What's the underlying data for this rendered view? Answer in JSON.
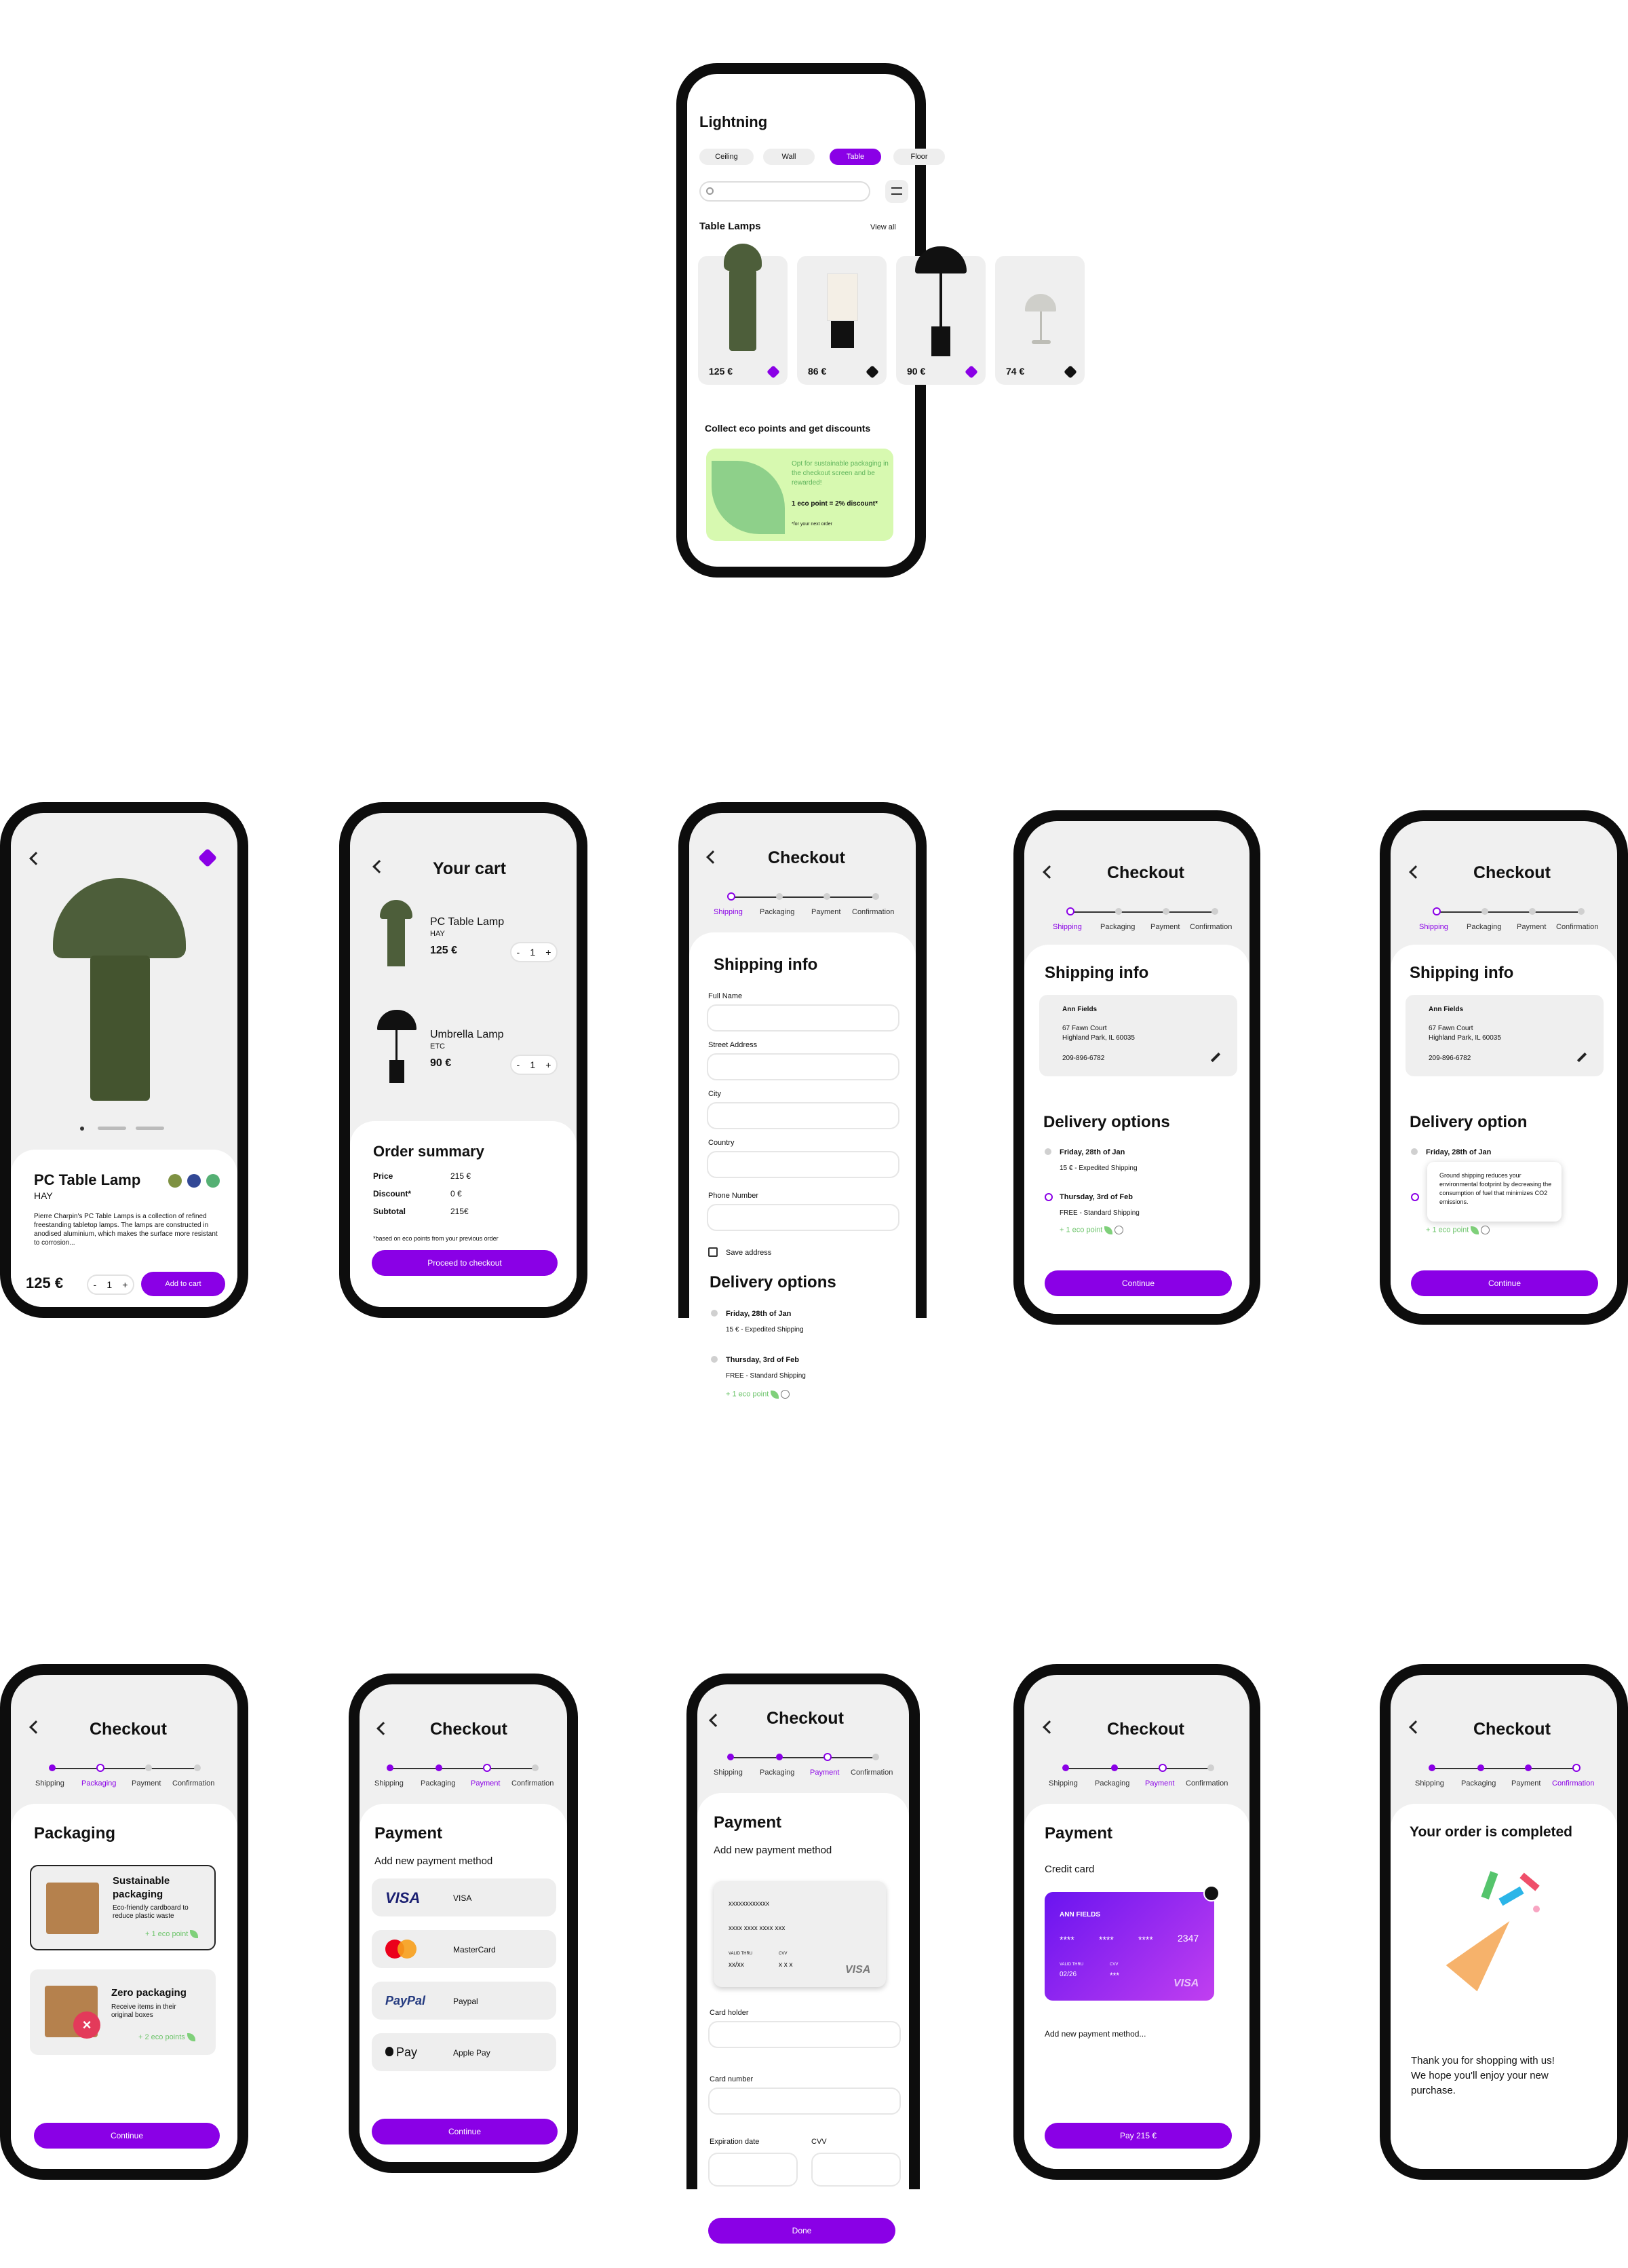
{
  "catalog": {
    "title": "Lightning",
    "chips": [
      "Ceiling",
      "Wall",
      "Table",
      "Floor"
    ],
    "section": "Table Lamps",
    "view_all": "View all",
    "prices": [
      "125 €",
      "86 €",
      "90 €",
      "74 €"
    ],
    "eco_title": "Collect eco points and get discounts",
    "eco_text1": "Opt for sustainable packaging in the checkout screen and be rewarded!",
    "eco_text2": "1 eco point = 2% discount*",
    "eco_text3": "*for your next order"
  },
  "product": {
    "name": "PC Table Lamp",
    "brand": "HAY",
    "desc": "Pierre Charpin's PC Table Lamps is a collection of refined freestanding tabletop lamps. The lamps are constructed in anodised aluminium, which makes the surface more resistant to corrosion...",
    "price": "125 €",
    "qty": "1",
    "add": "Add to cart"
  },
  "cart": {
    "title": "Your cart",
    "items": [
      {
        "name": "PC Table Lamp",
        "brand": "HAY",
        "price": "125 €",
        "qty": "1"
      },
      {
        "name": "Umbrella Lamp",
        "brand": "ETC",
        "price": "90 €",
        "qty": "1"
      }
    ],
    "summary": "Order summary",
    "rows": [
      {
        "k": "Price",
        "v": "215 €"
      },
      {
        "k": "Discount*",
        "v": "0 €"
      },
      {
        "k": "Subtotal",
        "v": "215€"
      }
    ],
    "note": "*based on eco points from your previous order",
    "cta": "Proceed to checkout"
  },
  "checkout": {
    "title": "Checkout",
    "steps": [
      "Shipping",
      "Packaging",
      "Payment",
      "Confirmation"
    ]
  },
  "shipping": {
    "title": "Shipping info",
    "fields": [
      "Full Name",
      "Street Address",
      "City",
      "Country",
      "Phone Number"
    ],
    "save": "Save address",
    "delivery": "Delivery options",
    "delivery_single": "Delivery option",
    "opt1": "Friday, 28th of Jan",
    "opt1b": "15 € - Expedited Shipping",
    "opt2": "Thursday, 3rd of Feb",
    "opt2b": "FREE - Standard Shipping",
    "eco": "+ 1 eco point",
    "name": "Ann Fields",
    "addr1": "67 Fawn Court",
    "addr2": "Highland Park, IL 60035",
    "phone": "209-896-6782",
    "cta": "Continue",
    "tooltip": "Ground shipping reduces your environmental footprint by decreasing the consumption of fuel that minimizes CO2 emissions."
  },
  "packaging": {
    "title": "Packaging",
    "o1": "Sustainable packaging",
    "o1d": "Eco-friendly cardboard to reduce plastic waste",
    "o1e": "+ 1 eco point",
    "o2": "Zero packaging",
    "o2d": "Receive items in their original boxes",
    "o2e": "+ 2 eco points",
    "cta": "Continue"
  },
  "payment": {
    "title": "Payment",
    "add": "Add new payment method",
    "methods": [
      "VISA",
      "MasterCard",
      "Paypal",
      "Apple Pay"
    ],
    "visa_logo": "VISA",
    "paypal_logo": "PayPal",
    "apple_logo": "Pay",
    "cta": "Continue",
    "card_name": "xxxxxxxxxxxx",
    "card_num": "xxxx xxxx xxxx xxx",
    "valid": "VALID THRU",
    "valid_v": "xx/xx",
    "cvv": "CVV",
    "cvv_v": "x x x",
    "f1": "Card holder",
    "f2": "Card number",
    "f3": "Expiration date",
    "f4": "CVV",
    "done": "Done",
    "cc_title": "Credit card",
    "cc_name": "ANN FIELDS",
    "cc_stars": "****",
    "cc_last": "2347",
    "cc_exp": "02/26",
    "cc_cvv": "***",
    "cc_add": "Add new payment method...",
    "pay": "Pay 215 €"
  },
  "done": {
    "title": "Your order is completed",
    "msg1": "Thank you for shopping with us!",
    "msg2": "We hope you'll enjoy your new",
    "msg3": "purchase."
  }
}
